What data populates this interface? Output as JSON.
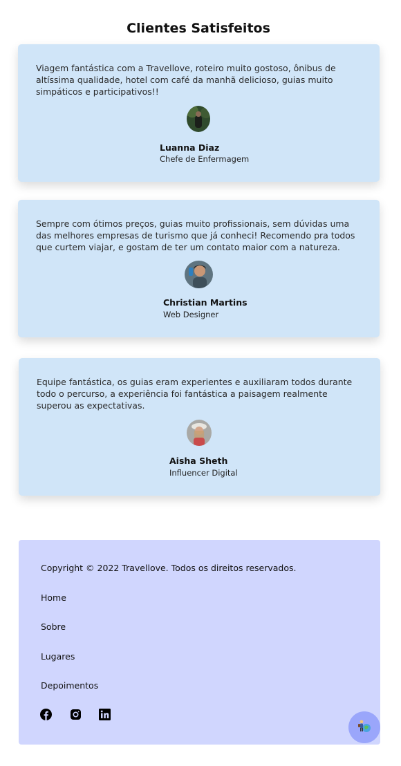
{
  "section_title": "Clientes Satisfeitos",
  "testimonials": [
    {
      "quote": "Viagem fantástica com a Travellove, roteiro muito gostoso, ônibus de altíssima qualidade, hotel com café da manhã delicioso, guias muito simpáticos e participativos!!",
      "name": "Luanna Diaz",
      "role": "Chefe de Enfermagem"
    },
    {
      "quote": "Sempre com ótimos preços, guias muito profissionais, sem dúvidas uma das melhores empresas de turismo que já conheci! Recomendo pra todos que curtem viajar, e gostam de ter um contato maior com a natureza.",
      "name": "Christian Martins",
      "role": "Web Designer"
    },
    {
      "quote": "Equipe fantástica, os guias eram experientes e auxiliaram todos durante todo o percurso, a experiência foi fantástica a paisagem realmente superou as expectativas.",
      "name": "Aisha Sheth",
      "role": "Influencer Digital"
    }
  ],
  "footer": {
    "copyright": "Copyright © 2022 Travellove. Todos os direitos reservados.",
    "links": [
      "Home",
      "Sobre",
      "Lugares",
      "Depoimentos"
    ],
    "social_icons": [
      "facebook-icon",
      "instagram-icon",
      "linkedin-icon"
    ]
  },
  "floating_button_icon": "traveler-icon",
  "colors": {
    "card_bg": "#d0e5f8",
    "footer_bg": "#d0d6fe",
    "fab_bg": "#9aa6fb"
  }
}
